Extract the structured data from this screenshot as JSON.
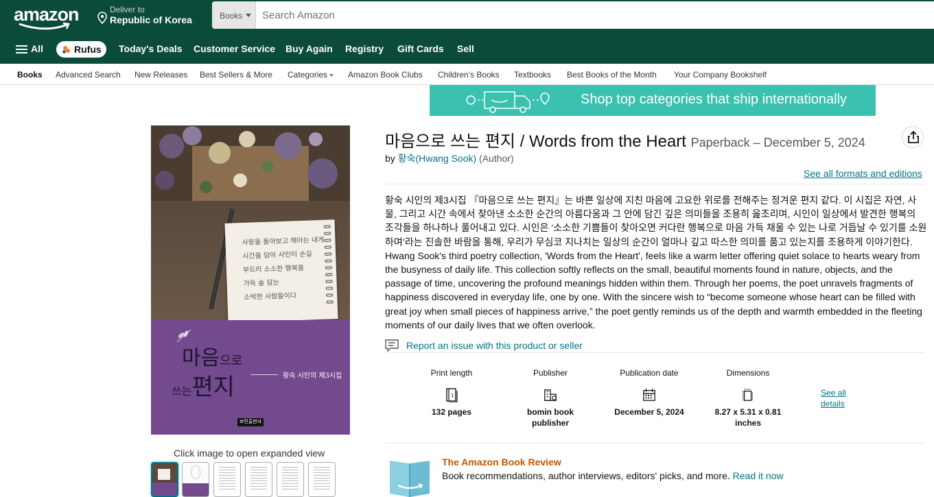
{
  "header": {
    "logo": "amazon",
    "deliver_line1": "Deliver to",
    "deliver_line2": "Republic of Korea",
    "search_category": "Books",
    "search_placeholder": "Search Amazon"
  },
  "main_nav": {
    "all": "All",
    "rufus": "Rufus",
    "items": [
      "Today's Deals",
      "Customer Service",
      "Buy Again",
      "Registry",
      "Gift Cards",
      "Sell"
    ]
  },
  "sub_nav": {
    "items": [
      "Books",
      "Advanced Search",
      "New Releases",
      "Best Sellers & More",
      "Categories",
      "Amazon Book Clubs",
      "Children's Books",
      "Textbooks",
      "Best Books of the Month",
      "Your Company Bookshelf"
    ]
  },
  "banner": {
    "text": "Shop top categories that ship internationally",
    "color": "#3ac1b0"
  },
  "gallery": {
    "hint": "Click image to open expanded view",
    "cover": {
      "title_main": "마음",
      "title_small": "으로",
      "title2_small": "쓰는",
      "title2_main": "편지",
      "author_line": "황숙 시인의 제3시집",
      "publisher_logo": "보민출판사",
      "note_lines": [
        "사랑을 돌아보고 헤아는 내게",
        "시간을 담아 사인이 손길",
        "부드러 소소한 행복을",
        "가득 솔 담는",
        "소박한 사람들이다"
      ]
    }
  },
  "product": {
    "title": "마음으로 쓰는 편지 / Words from the Heart",
    "format": "Paperback – December 5, 2024",
    "by": "by",
    "author": "황숙(Hwang Sook)",
    "author_role": "(Author)",
    "see_formats": "See all formats and editions",
    "description_ko": "황숙 시인의 제3시집 『마음으로 쓰는 편지』는 바쁜 일상에 지친 마음에 고요한 위로를 전해주는 정겨운 편지 같다. 이 시집은 자연, 사물, 그리고 시간 속에서 찾아낸 소소한 순간의 아름다움과 그 안에 담긴 깊은 의미들을 조용히 읊조리며, 시인이 일상에서 발견한 행복의 조각들을 하나하나 풀어내고 있다. 시인은 ‘소소한 기쁨들이 찾아오면 커다란 행복으로 마음 가득 채울 수 있는 나로 거듭날 수 있기를 소원하며’라는 진솔한 바람을 통해, 우리가 무심코 지나치는 일상의 순간이 얼마나 깊고 따스한 의미를 품고 있는지를 조용하게 이야기한다.",
    "description_en": "Hwang Sook's third poetry collection, 'Words from the Heart', feels like a warm letter offering quiet solace to hearts weary from the busyness of daily life. This collection softly reflects on the small, beautiful moments found in nature, objects, and the passage of time, uncovering the profound meanings hidden within them. Through her poems, the poet unravels fragments of happiness discovered in everyday life, one by one. With the sincere wish to “become someone whose heart can be filled with great joy when small pieces of happiness arrive,” the poet gently reminds us of the depth and warmth embedded in the fleeting moments of our daily lives that we often overlook.",
    "report": "Report an issue with this product or seller",
    "attributes": [
      {
        "label": "Print length",
        "icon": "page-count-icon",
        "value": "132 pages"
      },
      {
        "label": "Publisher",
        "icon": "building-icon",
        "value": "bomin book publisher"
      },
      {
        "label": "Publication date",
        "icon": "calendar-icon",
        "value": "December 5, 2024"
      },
      {
        "label": "Dimensions",
        "icon": "dimensions-icon",
        "value": "8.27 x 5.31 x 0.81 inches"
      }
    ],
    "see_all_details": "See all details"
  },
  "book_review": {
    "title": "The Amazon Book Review",
    "text": "Book recommendations, author interviews, editors' picks, and more.",
    "link": "Read it now"
  },
  "colors": {
    "header_bg": "#0b4b3a",
    "link": "#007185",
    "review_title": "#c45500",
    "cover_purple": "#734a8e"
  }
}
